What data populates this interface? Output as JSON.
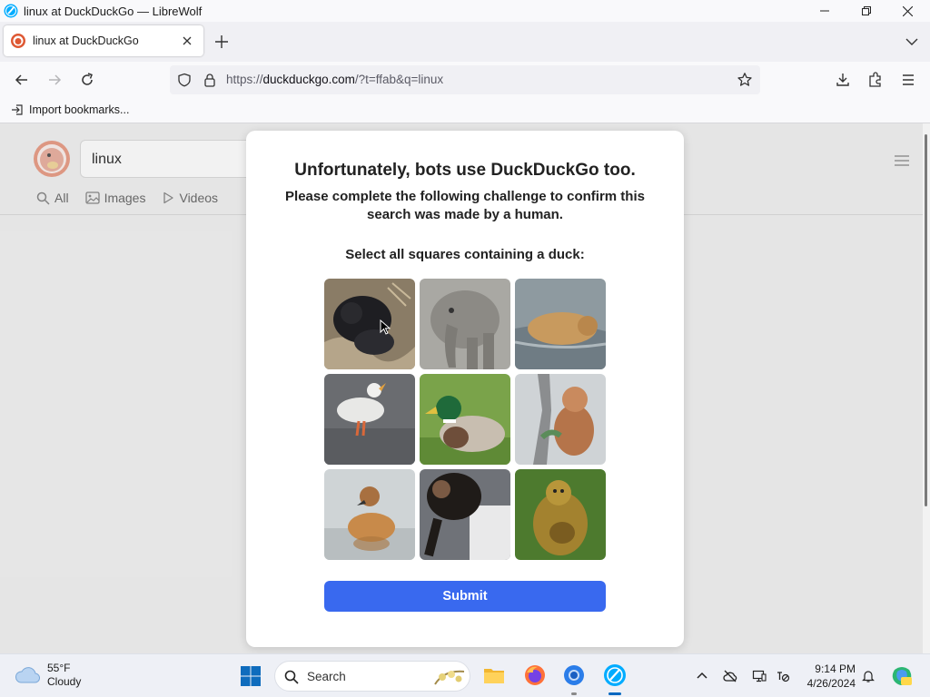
{
  "window": {
    "title": "linux at DuckDuckGo — LibreWolf"
  },
  "tab": {
    "label": "linux at DuckDuckGo"
  },
  "urlbar": {
    "url_prefix": "https://",
    "url_domain": "duckduckgo.com",
    "url_rest": "/?t=ffab&q=linux"
  },
  "bookmarks": {
    "import_label": "Import bookmarks..."
  },
  "page": {
    "search_query": "linux",
    "tabs": [
      {
        "label": "All",
        "icon": "search-icon"
      },
      {
        "label": "Images",
        "icon": "image-icon"
      },
      {
        "label": "Videos",
        "icon": "play-icon"
      }
    ]
  },
  "challenge": {
    "title": "Unfortunately, bots use DuckDuckGo too.",
    "subtitle": "Please complete the following challenge to confirm this search was made by a human.",
    "prompt": "Select all squares containing a duck:",
    "images": [
      {
        "subject": "gorilla"
      },
      {
        "subject": "elephant"
      },
      {
        "subject": "lion"
      },
      {
        "subject": "duck"
      },
      {
        "subject": "duck"
      },
      {
        "subject": "monkey"
      },
      {
        "subject": "duck"
      },
      {
        "subject": "chimpanzee"
      },
      {
        "subject": "monkey"
      }
    ],
    "submit_label": "Submit",
    "accent_color": "#3969ef"
  },
  "taskbar": {
    "weather_temp": "55°F",
    "weather_desc": "Cloudy",
    "search_placeholder": "Search",
    "time": "9:14 PM",
    "date": "4/26/2024"
  }
}
